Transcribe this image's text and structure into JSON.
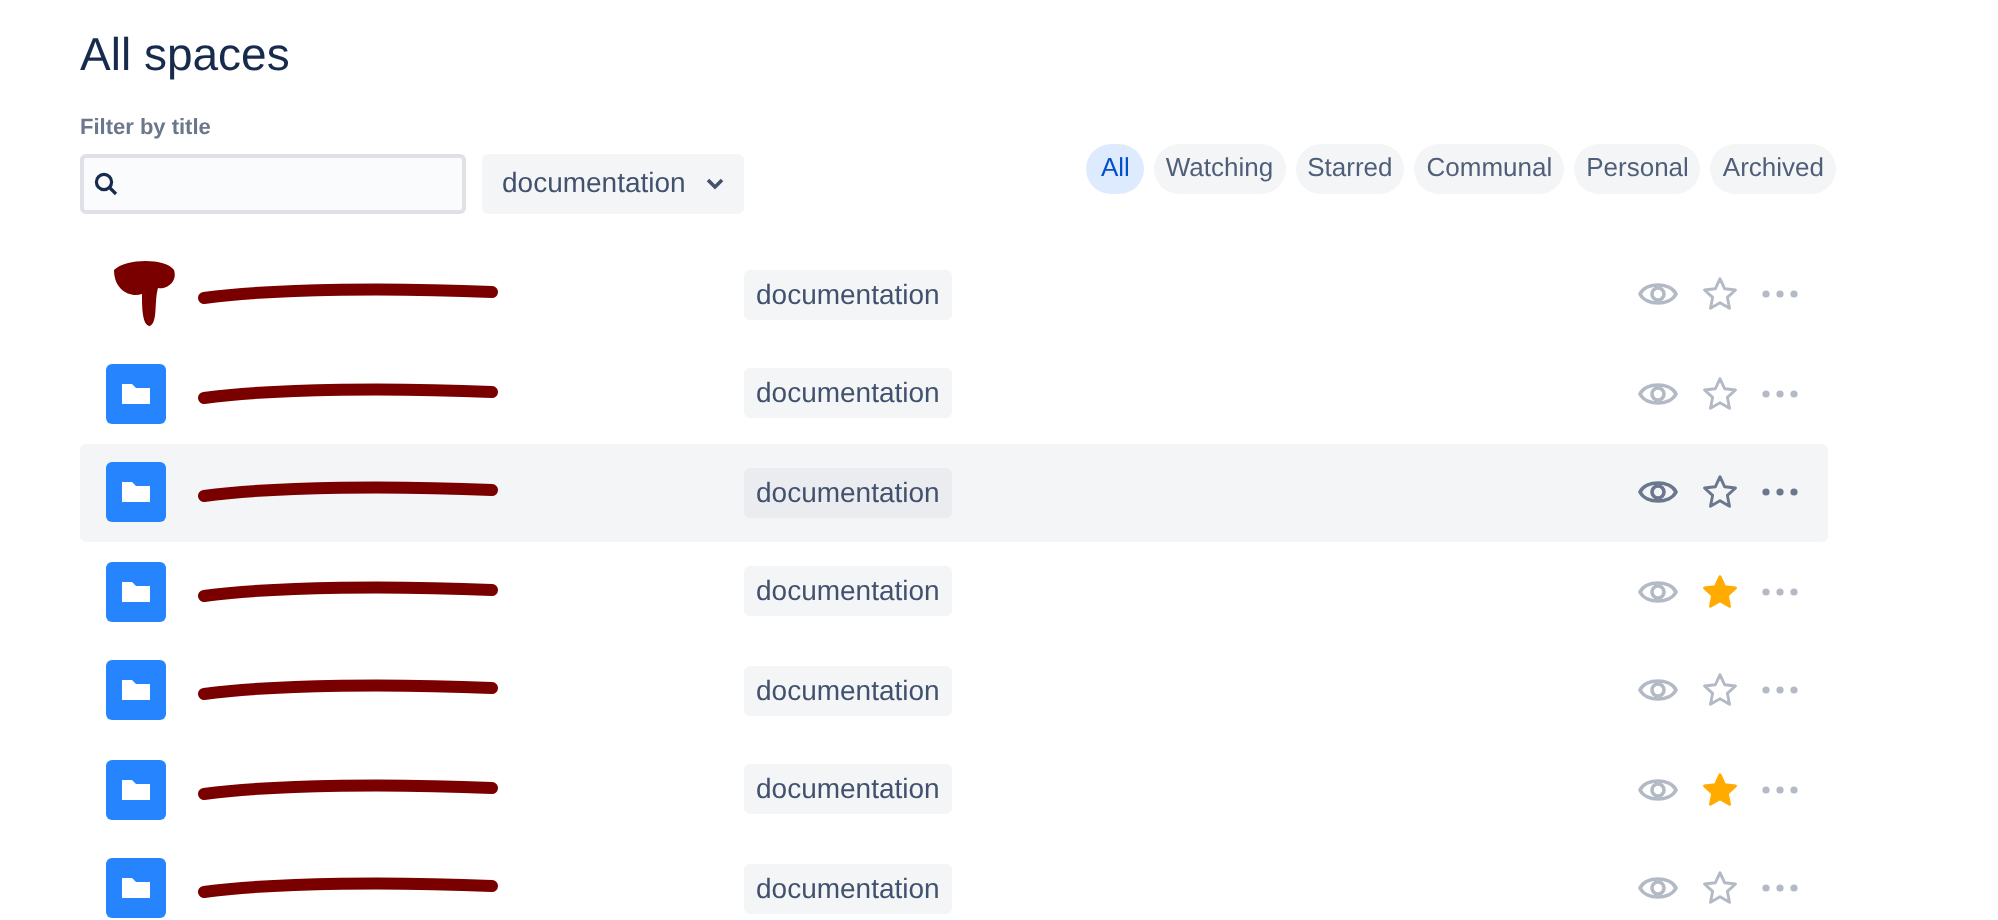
{
  "title": "All spaces",
  "filter": {
    "label": "Filter by title",
    "category": "documentation"
  },
  "tabs": [
    {
      "label": "All",
      "selected": true
    },
    {
      "label": "Watching",
      "selected": false
    },
    {
      "label": "Starred",
      "selected": false
    },
    {
      "label": "Communal",
      "selected": false
    },
    {
      "label": "Personal",
      "selected": false
    },
    {
      "label": "Archived",
      "selected": false
    }
  ],
  "spaces": [
    {
      "kind": "redacted",
      "name_redacted": true,
      "tag": "documentation",
      "hovered": false,
      "starred": false
    },
    {
      "kind": "folder",
      "name_redacted": true,
      "tag": "documentation",
      "hovered": false,
      "starred": false
    },
    {
      "kind": "folder",
      "name_redacted": true,
      "tag": "documentation",
      "hovered": true,
      "starred": false
    },
    {
      "kind": "folder",
      "name_redacted": true,
      "tag": "documentation",
      "hovered": false,
      "starred": true
    },
    {
      "kind": "folder",
      "name_redacted": true,
      "tag": "documentation",
      "hovered": false,
      "starred": false
    },
    {
      "kind": "folder",
      "name_redacted": true,
      "tag": "documentation",
      "hovered": false,
      "starred": true
    },
    {
      "kind": "folder",
      "name_redacted": true,
      "tag": "documentation",
      "hovered": false,
      "starred": false
    }
  ]
}
